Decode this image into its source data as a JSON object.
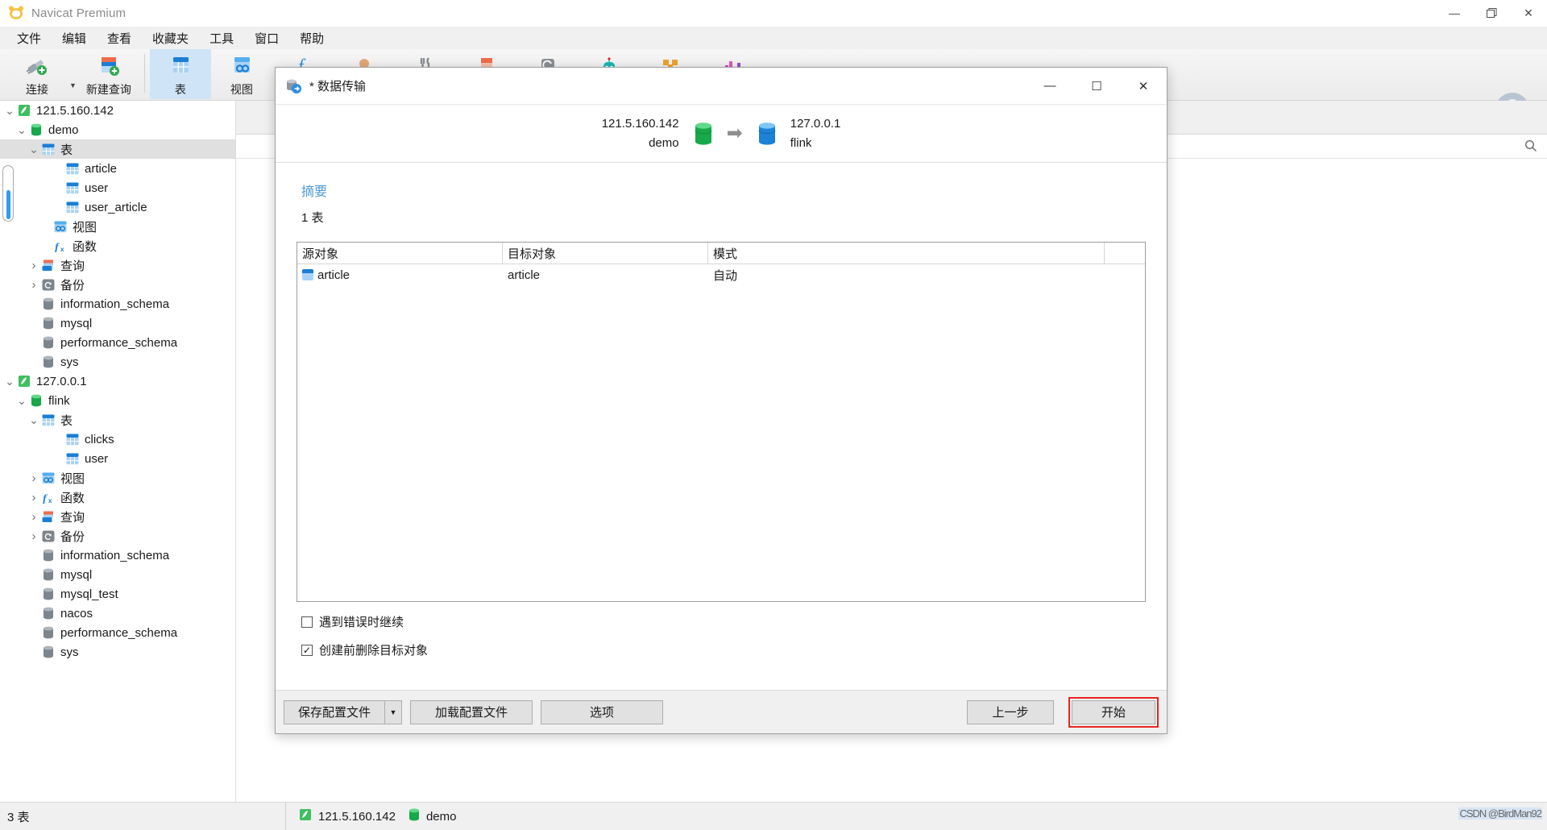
{
  "window": {
    "title": "Navicat Premium",
    "controls": {
      "minimize": "—",
      "maximize": "❐",
      "close": "✕"
    }
  },
  "menubar": {
    "items": [
      {
        "label": "文件",
        "name": "menu-file"
      },
      {
        "label": "编辑",
        "name": "menu-edit"
      },
      {
        "label": "查看",
        "name": "menu-view"
      },
      {
        "label": "收藏夹",
        "name": "menu-favorites"
      },
      {
        "label": "工具",
        "name": "menu-tools"
      },
      {
        "label": "窗口",
        "name": "menu-window"
      },
      {
        "label": "帮助",
        "name": "menu-help"
      }
    ]
  },
  "toolbar": {
    "items": [
      {
        "label": "连接",
        "icon": "connection-icon",
        "selected": false
      },
      {
        "label": "新建查询",
        "icon": "new-query-icon",
        "selected": false
      },
      {
        "label": "表",
        "icon": "table-icon",
        "selected": true
      },
      {
        "label": "视图",
        "icon": "view-icon",
        "selected": false
      }
    ],
    "extra_icons": [
      "function-icon",
      "user-icon",
      "maintain-icon",
      "import-icon",
      "backup-icon",
      "automation-icon",
      "model-icon",
      "chart-icon"
    ]
  },
  "sidebar": {
    "scroll_thumb": true,
    "items": [
      {
        "label": "121.5.160.142",
        "indent": 0,
        "twisty": "⌄",
        "icon": "server-green-icon",
        "selected": false
      },
      {
        "label": "demo",
        "indent": 1,
        "twisty": "⌄",
        "icon": "database-green-icon",
        "selected": false
      },
      {
        "label": "表",
        "indent": 2,
        "twisty": "⌄",
        "icon": "table-folder-icon",
        "selected": true
      },
      {
        "label": "article",
        "indent": 4,
        "twisty": "",
        "icon": "table-icon",
        "selected": false
      },
      {
        "label": "user",
        "indent": 4,
        "twisty": "",
        "icon": "table-icon",
        "selected": false
      },
      {
        "label": "user_article",
        "indent": 4,
        "twisty": "",
        "icon": "table-icon",
        "selected": false
      },
      {
        "label": "视图",
        "indent": 3,
        "twisty": "",
        "icon": "view-icon",
        "selected": false
      },
      {
        "label": "函数",
        "indent": 3,
        "twisty": "",
        "icon": "function-icon",
        "selected": false
      },
      {
        "label": "查询",
        "indent": 2,
        "twisty": "›",
        "icon": "query-icon",
        "selected": false
      },
      {
        "label": "备份",
        "indent": 2,
        "twisty": "›",
        "icon": "backup-icon",
        "selected": false
      },
      {
        "label": "information_schema",
        "indent": 2,
        "twisty": "",
        "icon": "database-gray-icon",
        "selected": false
      },
      {
        "label": "mysql",
        "indent": 2,
        "twisty": "",
        "icon": "database-gray-icon",
        "selected": false
      },
      {
        "label": "performance_schema",
        "indent": 2,
        "twisty": "",
        "icon": "database-gray-icon",
        "selected": false
      },
      {
        "label": "sys",
        "indent": 2,
        "twisty": "",
        "icon": "database-gray-icon",
        "selected": false
      },
      {
        "label": "127.0.0.1",
        "indent": 0,
        "twisty": "⌄",
        "icon": "server-green-icon",
        "selected": false
      },
      {
        "label": "flink",
        "indent": 1,
        "twisty": "⌄",
        "icon": "database-green-icon",
        "selected": false
      },
      {
        "label": "表",
        "indent": 2,
        "twisty": "⌄",
        "icon": "table-folder-icon",
        "selected": false
      },
      {
        "label": "clicks",
        "indent": 4,
        "twisty": "",
        "icon": "table-icon",
        "selected": false
      },
      {
        "label": "user",
        "indent": 4,
        "twisty": "",
        "icon": "table-icon",
        "selected": false
      },
      {
        "label": "视图",
        "indent": 2,
        "twisty": "›",
        "icon": "view-icon",
        "selected": false
      },
      {
        "label": "函数",
        "indent": 2,
        "twisty": "›",
        "icon": "function-icon",
        "selected": false
      },
      {
        "label": "查询",
        "indent": 2,
        "twisty": "›",
        "icon": "query-icon",
        "selected": false
      },
      {
        "label": "备份",
        "indent": 2,
        "twisty": "›",
        "icon": "backup-icon",
        "selected": false
      },
      {
        "label": "information_schema",
        "indent": 2,
        "twisty": "",
        "icon": "database-gray-icon",
        "selected": false
      },
      {
        "label": "mysql",
        "indent": 2,
        "twisty": "",
        "icon": "database-gray-icon",
        "selected": false
      },
      {
        "label": "mysql_test",
        "indent": 2,
        "twisty": "",
        "icon": "database-gray-icon",
        "selected": false
      },
      {
        "label": "nacos",
        "indent": 2,
        "twisty": "",
        "icon": "database-gray-icon",
        "selected": false
      },
      {
        "label": "performance_schema",
        "indent": 2,
        "twisty": "",
        "icon": "database-gray-icon",
        "selected": false
      },
      {
        "label": "sys",
        "indent": 2,
        "twisty": "",
        "icon": "database-gray-icon",
        "selected": false
      }
    ]
  },
  "dialog": {
    "title": "* 数据传输",
    "controls": {
      "minimize": "—",
      "maximize": "☐",
      "close": "✕"
    },
    "source": {
      "host": "121.5.160.142",
      "database": "demo"
    },
    "target": {
      "host": "127.0.0.1",
      "database": "flink"
    },
    "arrow": "➡",
    "summary_title": "摘要",
    "summary_count": "1 表",
    "grid": {
      "headers": [
        "源对象",
        "目标对象",
        "模式",
        ""
      ],
      "rows": [
        {
          "source": "article",
          "target": "article",
          "mode": "自动"
        }
      ]
    },
    "options": [
      {
        "label": "遇到错误时继续",
        "checked": false,
        "mark": ""
      },
      {
        "label": "创建前删除目标对象",
        "checked": true,
        "mark": "✓"
      }
    ],
    "buttons": {
      "save_profile": "保存配置文件",
      "save_profile_caret": "▼",
      "load_profile": "加载配置文件",
      "options": "选项",
      "previous": "上一步",
      "start": "开始"
    },
    "accent_highlight": "#e8251f"
  },
  "statusbar": {
    "left": "3 表",
    "host": "121.5.160.142",
    "database": "demo",
    "watermark": "CSDN @BirdMan92"
  }
}
